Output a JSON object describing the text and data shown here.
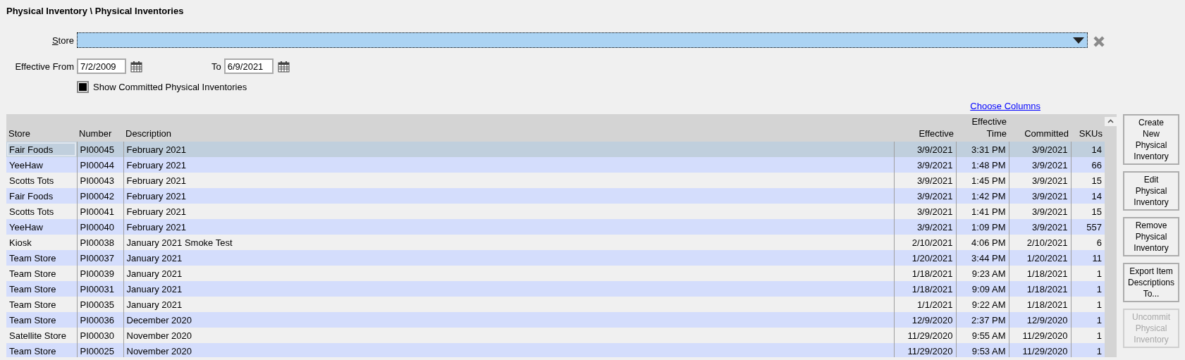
{
  "title": "Physical Inventory \\ Physical Inventories",
  "filters": {
    "store": {
      "label": "Store"
    },
    "effective_from": {
      "label": "Effective From",
      "value": "7/2/2009"
    },
    "to": {
      "label": "To",
      "value": "6/9/2021"
    },
    "show_committed": {
      "label": "Show Committed Physical Inventories",
      "checked": true
    }
  },
  "choose_columns": "Choose Columns",
  "table": {
    "columns": [
      {
        "label": "Store",
        "kind": "text"
      },
      {
        "label": "Number",
        "kind": "text"
      },
      {
        "label": "Description",
        "kind": "text"
      },
      {
        "label": "Effective",
        "kind": "number"
      },
      {
        "label": "Effective Time",
        "kind": "number"
      },
      {
        "label": "Committed",
        "kind": "number"
      },
      {
        "label": "SKUs",
        "kind": "number"
      }
    ],
    "rows": [
      {
        "selected": true,
        "cells": [
          "Fair Foods",
          "PI00045",
          "February 2021",
          "3/9/2021",
          "3:31 PM",
          "3/9/2021",
          "14"
        ]
      },
      {
        "selected": false,
        "cells": [
          "YeeHaw",
          "PI00044",
          "February 2021",
          "3/9/2021",
          "1:48 PM",
          "3/9/2021",
          "66"
        ]
      },
      {
        "selected": false,
        "cells": [
          "Scotts Tots",
          "PI00043",
          "February 2021",
          "3/9/2021",
          "1:45 PM",
          "3/9/2021",
          "15"
        ]
      },
      {
        "selected": false,
        "cells": [
          "Fair Foods",
          "PI00042",
          "February 2021",
          "3/9/2021",
          "1:42 PM",
          "3/9/2021",
          "14"
        ]
      },
      {
        "selected": false,
        "cells": [
          "Scotts Tots",
          "PI00041",
          "February 2021",
          "3/9/2021",
          "1:41 PM",
          "3/9/2021",
          "15"
        ]
      },
      {
        "selected": false,
        "cells": [
          "YeeHaw",
          "PI00040",
          "February 2021",
          "3/9/2021",
          "1:09 PM",
          "3/9/2021",
          "557"
        ]
      },
      {
        "selected": false,
        "cells": [
          "Kiosk",
          "PI00038",
          "January 2021 Smoke Test",
          "2/10/2021",
          "4:06 PM",
          "2/10/2021",
          "6"
        ]
      },
      {
        "selected": false,
        "cells": [
          "Team Store",
          "PI00037",
          "January 2021",
          "1/20/2021",
          "3:44 PM",
          "1/20/2021",
          "11"
        ]
      },
      {
        "selected": false,
        "cells": [
          "Team Store",
          "PI00039",
          "January 2021",
          "1/18/2021",
          "9:23 AM",
          "1/18/2021",
          "1"
        ]
      },
      {
        "selected": false,
        "cells": [
          "Team Store",
          "PI00031",
          "January 2021",
          "1/18/2021",
          "9:09 AM",
          "1/18/2021",
          "1"
        ]
      },
      {
        "selected": false,
        "cells": [
          "Team Store",
          "PI00035",
          "January 2021",
          "1/1/2021",
          "9:22 AM",
          "1/18/2021",
          "1"
        ]
      },
      {
        "selected": false,
        "cells": [
          "Team Store",
          "PI00036",
          "December 2020",
          "12/9/2020",
          "2:37 PM",
          "12/9/2020",
          "1"
        ]
      },
      {
        "selected": false,
        "cells": [
          "Satellite Store",
          "PI00030",
          "November 2020",
          "11/29/2020",
          "9:55 AM",
          "11/29/2020",
          "1"
        ]
      },
      {
        "selected": false,
        "cells": [
          "Team Store",
          "PI00025",
          "November 2020",
          "11/29/2020",
          "9:53 AM",
          "11/29/2020",
          "1"
        ]
      }
    ]
  },
  "buttons": [
    {
      "label": "Create\nNew\nPhysical\nInventory",
      "disabled": false
    },
    {
      "label": "Edit\nPhysical\nInventory",
      "disabled": false
    },
    {
      "label": "Remove\nPhysical\nInventory",
      "disabled": false
    },
    {
      "label": "Export Item\nDescriptions\nTo...",
      "disabled": false
    },
    {
      "label": "Uncommit\nPhysical\nInventory",
      "disabled": true
    }
  ]
}
